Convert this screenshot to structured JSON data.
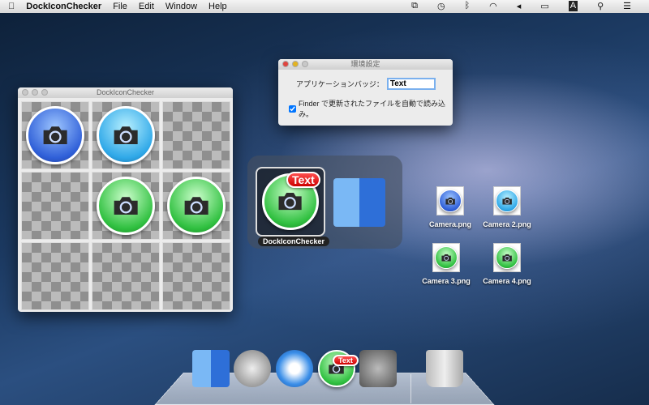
{
  "menubar": {
    "apple_icon": "apple-icon",
    "app_name": "DockIconChecker",
    "items": [
      "File",
      "Edit",
      "Window",
      "Help"
    ],
    "status_icons": [
      "mirroring-icon",
      "time-machine-icon",
      "bluetooth-icon",
      "wifi-icon",
      "volume-icon",
      "battery-icon",
      "input-source-icon",
      "spotlight-icon",
      "notification-center-icon"
    ]
  },
  "grid_window": {
    "title": "DockIconChecker",
    "cells": [
      "blue",
      "cyan",
      "empty",
      "empty",
      "green",
      "green",
      "empty",
      "empty",
      "empty"
    ]
  },
  "prefs_window": {
    "title": "環境設定",
    "badge_label": "アプリケーションバッジ：",
    "badge_value": "Text",
    "auto_load_label": "Finder で更新されたファイルを自動で読み込み。",
    "auto_load_checked": true
  },
  "switcher": {
    "app_label": "DockIconChecker",
    "badge": "Text"
  },
  "desktop_files": [
    {
      "name": "Camera.png",
      "color": "blue"
    },
    {
      "name": "Camera 2.png",
      "color": "cyan"
    },
    {
      "name": "Camera 3.png",
      "color": "green"
    },
    {
      "name": "Camera 4.png",
      "color": "green"
    }
  ],
  "dock": {
    "items": [
      "Finder",
      "Launchpad",
      "Safari",
      "DockIconChecker",
      "System Preferences",
      "Trash"
    ],
    "badge": "Text"
  }
}
